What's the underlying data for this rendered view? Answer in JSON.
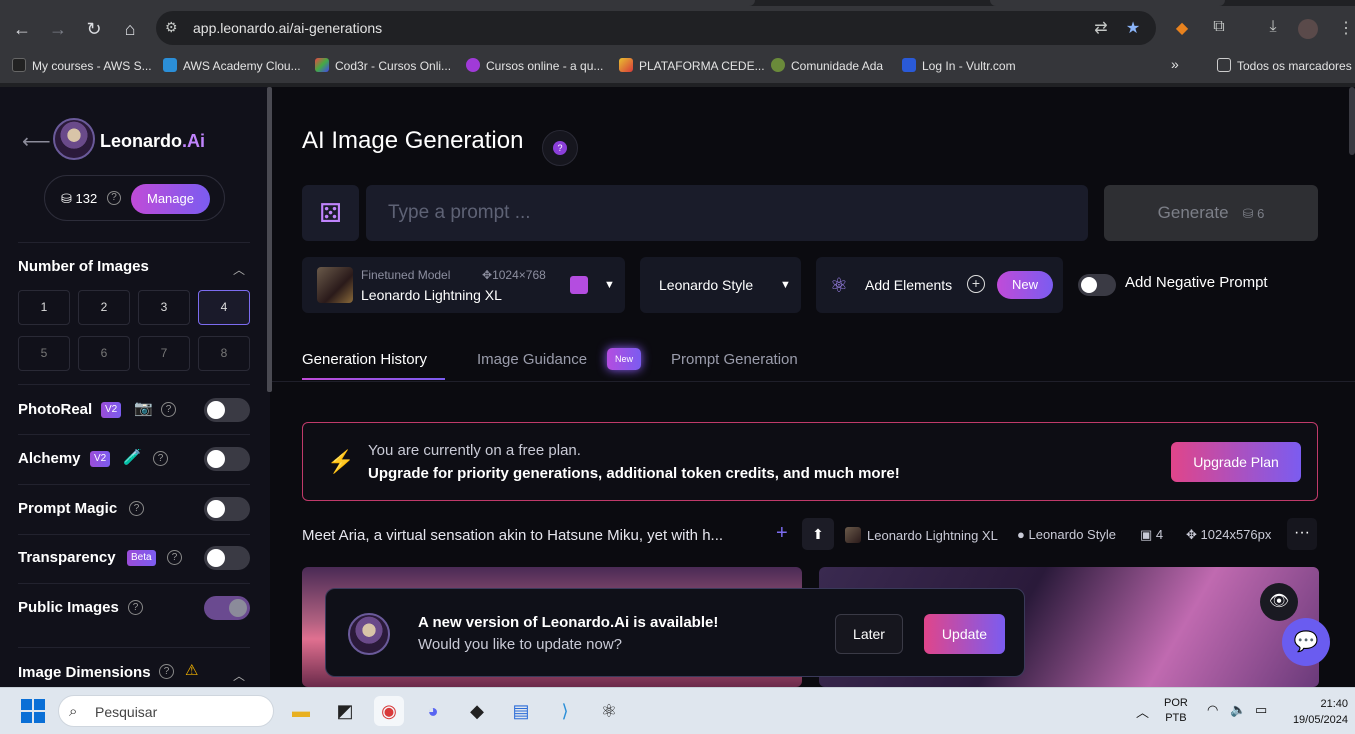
{
  "browser": {
    "url": "app.leonardo.ai/ai-generations",
    "bookmarks": [
      "My courses - AWS S...",
      "AWS Academy Clou...",
      "Cod3r - Cursos Onli...",
      "Cursos online - a qu...",
      "PLATAFORMA CEDE...",
      "Comunidade Ada",
      "Log In - Vultr.com"
    ],
    "all_bookmarks": "Todos os marcadores",
    "more_bookmarks": "»"
  },
  "sidebar": {
    "back": "⟵",
    "brand": "Leonardo",
    "brand_suffix": ".Ai",
    "tokens": "132",
    "manage": "Manage",
    "number_of_images": "Number of Images",
    "numbers": [
      "1",
      "2",
      "3",
      "4",
      "5",
      "6",
      "7",
      "8"
    ],
    "selected_number": "4",
    "options": [
      {
        "label": "PhotoReal",
        "badge": "V2",
        "on": false
      },
      {
        "label": "Alchemy",
        "badge": "V2",
        "on": false
      },
      {
        "label": "Prompt Magic",
        "badge": "",
        "on": false
      },
      {
        "label": "Transparency",
        "badge": "Beta",
        "on": false
      },
      {
        "label": "Public Images",
        "badge": "",
        "on": true
      }
    ],
    "image_dimensions": "Image Dimensions"
  },
  "main": {
    "title": "AI Image Generation",
    "help": "?",
    "prompt_placeholder": "Type a prompt ...",
    "generate": "Generate",
    "generate_cost": "6",
    "model_caption": "Finetuned Model",
    "model_dims": "1024×768",
    "model_name": "Leonardo Lightning XL",
    "style": "Leonardo Style",
    "add_elements": "Add Elements",
    "new_badge": "New",
    "negative_prompt": "Add Negative Prompt",
    "tabs": [
      "Generation History",
      "Image Guidance",
      "Prompt Generation"
    ],
    "tab_new": "New",
    "banner_line1": "You are currently on a free plan.",
    "banner_line2": "Upgrade for priority generations, additional token credits, and much more!",
    "upgrade": "Upgrade Plan",
    "generation": {
      "prompt": "Meet Aria, a virtual sensation akin to Hatsune Miku, yet with h...",
      "model": "Leonardo Lightning XL",
      "style": "Leonardo Style",
      "count": "4",
      "dims": "1024x576px",
      "more": "···"
    }
  },
  "toast": {
    "heading": "A new version of Leonardo.Ai is available!",
    "sub": "Would you like to update now?",
    "later": "Later",
    "update": "Update"
  },
  "taskbar": {
    "search": "Pesquisar",
    "lang1": "POR",
    "lang2": "PTB",
    "time": "21:40",
    "date": "19/05/2024"
  }
}
